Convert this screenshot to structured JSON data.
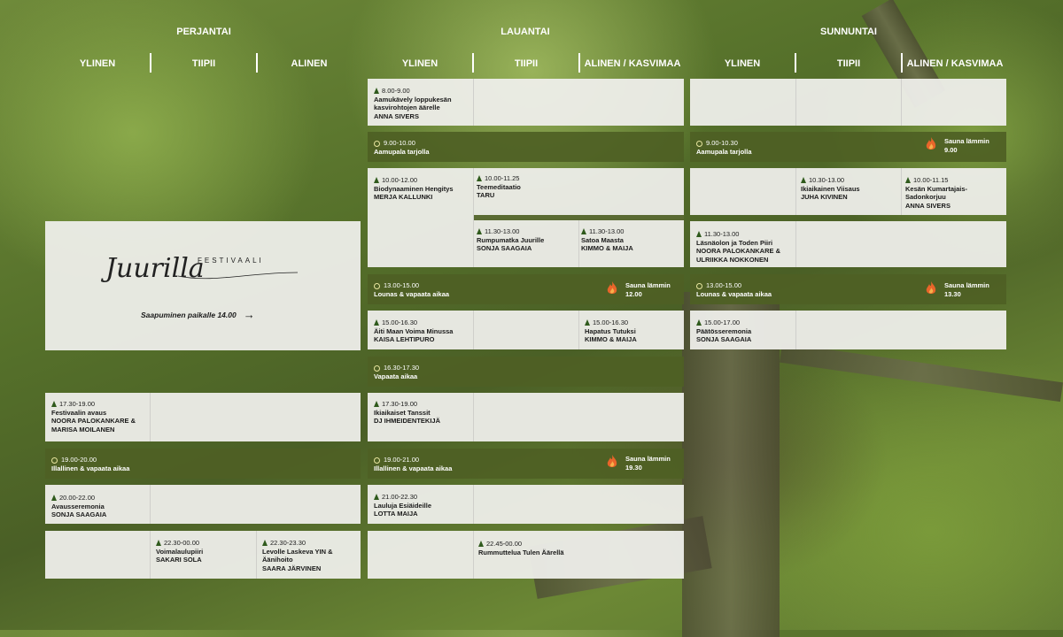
{
  "days": {
    "friday": "PERJANTAI",
    "saturday": "LAUANTAI",
    "sunday": "SUNNUNTAI"
  },
  "stages": {
    "friday": [
      "YLINEN",
      "TIIPII",
      "ALINEN"
    ],
    "saturday": [
      "YLINEN",
      "TIIPII",
      "ALINEN  / KASVIMAA"
    ],
    "sunday": [
      "YLINEN",
      "TIIPII",
      "ALINEN  / KASVIMAA"
    ]
  },
  "logo": {
    "script": "Juurilla",
    "word": "FESTIVAALI",
    "arrival": "Saapuminen paikalle 14.00",
    "arrow": "→"
  },
  "friday": {
    "e1": {
      "time": "17.30-19.00",
      "title": "Festivaalin avaus",
      "people": "NOORA PALOKANKARE &\nMARISA MOILANEN"
    },
    "b1": {
      "time": "19.00-20.00",
      "title": "Illallinen & vapaata aikaa"
    },
    "e2": {
      "time": "20.00-22.00",
      "title": "Avausseremonia",
      "people": "SONJA SAAGAIA"
    },
    "e3": {
      "time": "22.30-00.00",
      "title": "Voimalaulupiiri",
      "people": "SAKARI SOLA"
    },
    "e4": {
      "time": "22.30-23.30",
      "title": "Levolle Laskeva YIN &\nÄänihoito",
      "people": "SAARA JÄRVINEN"
    }
  },
  "saturday": {
    "e1": {
      "time": "8.00-9.00",
      "title": "Aamukävely loppukesän\nkasvirohtojen äärelle",
      "people": "ANNA SIVERS"
    },
    "b1": {
      "time": "9.00-10.00",
      "title": "Aamupala tarjolla"
    },
    "e2": {
      "time": "10.00-12.00",
      "title": "Biodynaaminen Hengitys",
      "people": "MERJA KALLUNKI"
    },
    "e3": {
      "time": "10.00-11.25",
      "title": "Teemeditaatio",
      "people": "TARU"
    },
    "e4": {
      "time": "11.30-13.00",
      "title": "Rumpumatka Juurille",
      "people": "SONJA SAAGAIA"
    },
    "e5": {
      "time": "11.30-13.00",
      "title": "Satoa Maasta",
      "people": "KIMMO & MAIJA"
    },
    "b2": {
      "time": "13.00-15.00",
      "title": "Lounas & vapaata aikaa",
      "sauna": "Sauna lämmin\n12.00"
    },
    "e6": {
      "time": "15.00-16.30",
      "title": "Äiti Maan Voima Minussa",
      "people": "KAISA LEHTIPURO"
    },
    "e7": {
      "time": "15.00-16.30",
      "title": "Hapatus Tutuksi",
      "people": "KIMMO & MAIJA"
    },
    "b3": {
      "time": "16.30-17.30",
      "title": "Vapaata aikaa"
    },
    "e8": {
      "time": "17.30-19.00",
      "title": "Ikiaikaiset Tanssit",
      "people": "DJ IHMEIDENTEKIJÄ"
    },
    "b4": {
      "time": "19.00-21.00",
      "title": "Illallinen & vapaata aikaa",
      "sauna": "Sauna lämmin\n19.30"
    },
    "e9": {
      "time": "21.00-22.30",
      "title": "Lauluja Esiäideille",
      "people": "LOTTA MAIJA"
    },
    "e10": {
      "time": "22.45-00.00",
      "title": "Rummuttelua Tulen Äärellä",
      "people": ""
    }
  },
  "sunday": {
    "b1": {
      "time": "9.00-10.30",
      "title": "Aamupala tarjolla",
      "sauna": "Sauna lämmin\n9.00"
    },
    "e1": {
      "time": "10.30-13.00",
      "title": "Ikiaikainen Viisaus",
      "people": "JUHA KIVINEN"
    },
    "e2": {
      "time": "10.00-11.15",
      "title": "Kesän Kumartajais-\nSadonkorjuu",
      "people": "ANNA SIVERS"
    },
    "e3": {
      "time": "11.30-13.00",
      "title": "Läsnäolon ja Toden Piiri",
      "people": "NOORA PALOKANKARE &\nULRIIKKA NOKKONEN"
    },
    "b2": {
      "time": "13.00-15.00",
      "title": "Lounas & vapaata aikaa",
      "sauna": "Sauna lämmin\n13.30"
    },
    "e4": {
      "time": "15.00-17.00",
      "title": "Päätösseremonia",
      "people": "SONJA SAAGAIA"
    }
  },
  "icons": {
    "event": "tree-icon",
    "break": "clock-icon",
    "sauna": "flame-icon"
  },
  "colors": {
    "band": "#4e6024",
    "box": "#eeeeea",
    "text": "#1a1a1a"
  }
}
